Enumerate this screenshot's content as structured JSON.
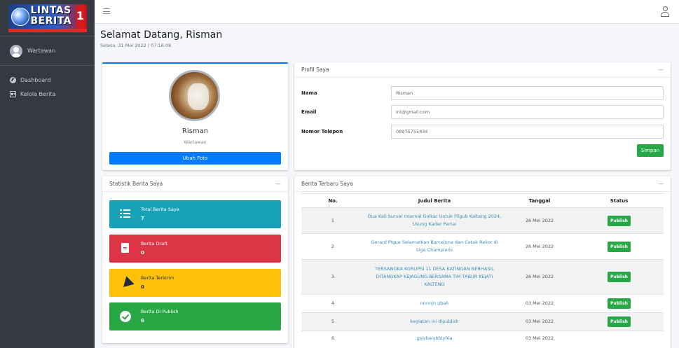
{
  "sidebar": {
    "logo_line1": "LINTAS",
    "logo_line2": "BERITA",
    "logo_digit": "1",
    "user_role": "Wartawan",
    "nav": [
      {
        "label": "Dashboard",
        "icon": "dashboard-icon"
      },
      {
        "label": "Kelola Berita",
        "icon": "newspaper-icon"
      }
    ]
  },
  "header": {
    "menu_icon": "hamburger-icon",
    "user_icon": "user-icon",
    "welcome": "Selamat Datang, Risman",
    "datetime": "Selasa, 31 Mei 2022 / 07:16:08"
  },
  "profile": {
    "name": "Risman",
    "role": "Wartawan",
    "change_photo_label": "Ubah Foto"
  },
  "profil_saya": {
    "title": "Profil Saya",
    "collapse": "—",
    "fields": [
      {
        "label": "Nama",
        "value": "Risman"
      },
      {
        "label": "Email",
        "value": "ini@gmail.com"
      },
      {
        "label": "Nomor Telepon",
        "value": "08975755434"
      }
    ],
    "save_label": "Simpan"
  },
  "statistik": {
    "title": "Statistik Berita Saya",
    "collapse": "—",
    "boxes": [
      {
        "title": "Total Berita Saya",
        "value": "7",
        "color": "#17a2b8",
        "icon": "list-icon"
      },
      {
        "title": "Berita Draft",
        "value": "0",
        "color": "#dc3545",
        "icon": "file-icon"
      },
      {
        "title": "Berita Terkirim",
        "value": "0",
        "color": "#ffc107",
        "icon": "paper-plane-icon"
      },
      {
        "title": "Berita Di Publish",
        "value": "6",
        "color": "#28a745",
        "icon": "check-circle-icon"
      }
    ]
  },
  "berita": {
    "title": "Berita Terbaru Saya",
    "collapse": "—",
    "columns": [
      "No.",
      "Judul Berita",
      "Tanggal",
      "Status"
    ],
    "rows": [
      {
        "no": "1",
        "judul": "Dua Kali Survei Internal Golkar Untuk Pilgub Kalteng 2024, Usung Kader Partai",
        "tanggal": "26 Mei 2022",
        "status": "Publish"
      },
      {
        "no": "2",
        "judul": "Gerard Pique Selamatkan Barcelona dan Cetak Rekor di Liga Champions",
        "tanggal": "26 Mei 2022",
        "status": "Publish"
      },
      {
        "no": "3",
        "judul": "TERSANGKA KORUPSI 11 DESA KATINGAN BERHASIL DITANGKAP KEJAGUNG BERSAMA TIM TABUR KEJATI KALTENG",
        "tanggal": "26 Mei 2022",
        "status": "Publish"
      },
      {
        "no": "4",
        "judul": "nnnnjn ubah",
        "tanggal": "03 Mei 2022",
        "status": "Publish"
      },
      {
        "no": "5",
        "judul": "kegiatan ini dipublish",
        "tanggal": "03 Mei 2022",
        "status": "Publish"
      },
      {
        "no": "6",
        "judul": "gsiybaiybbiyhia",
        "tanggal": "03 Mei 2022",
        "status": ""
      }
    ]
  }
}
